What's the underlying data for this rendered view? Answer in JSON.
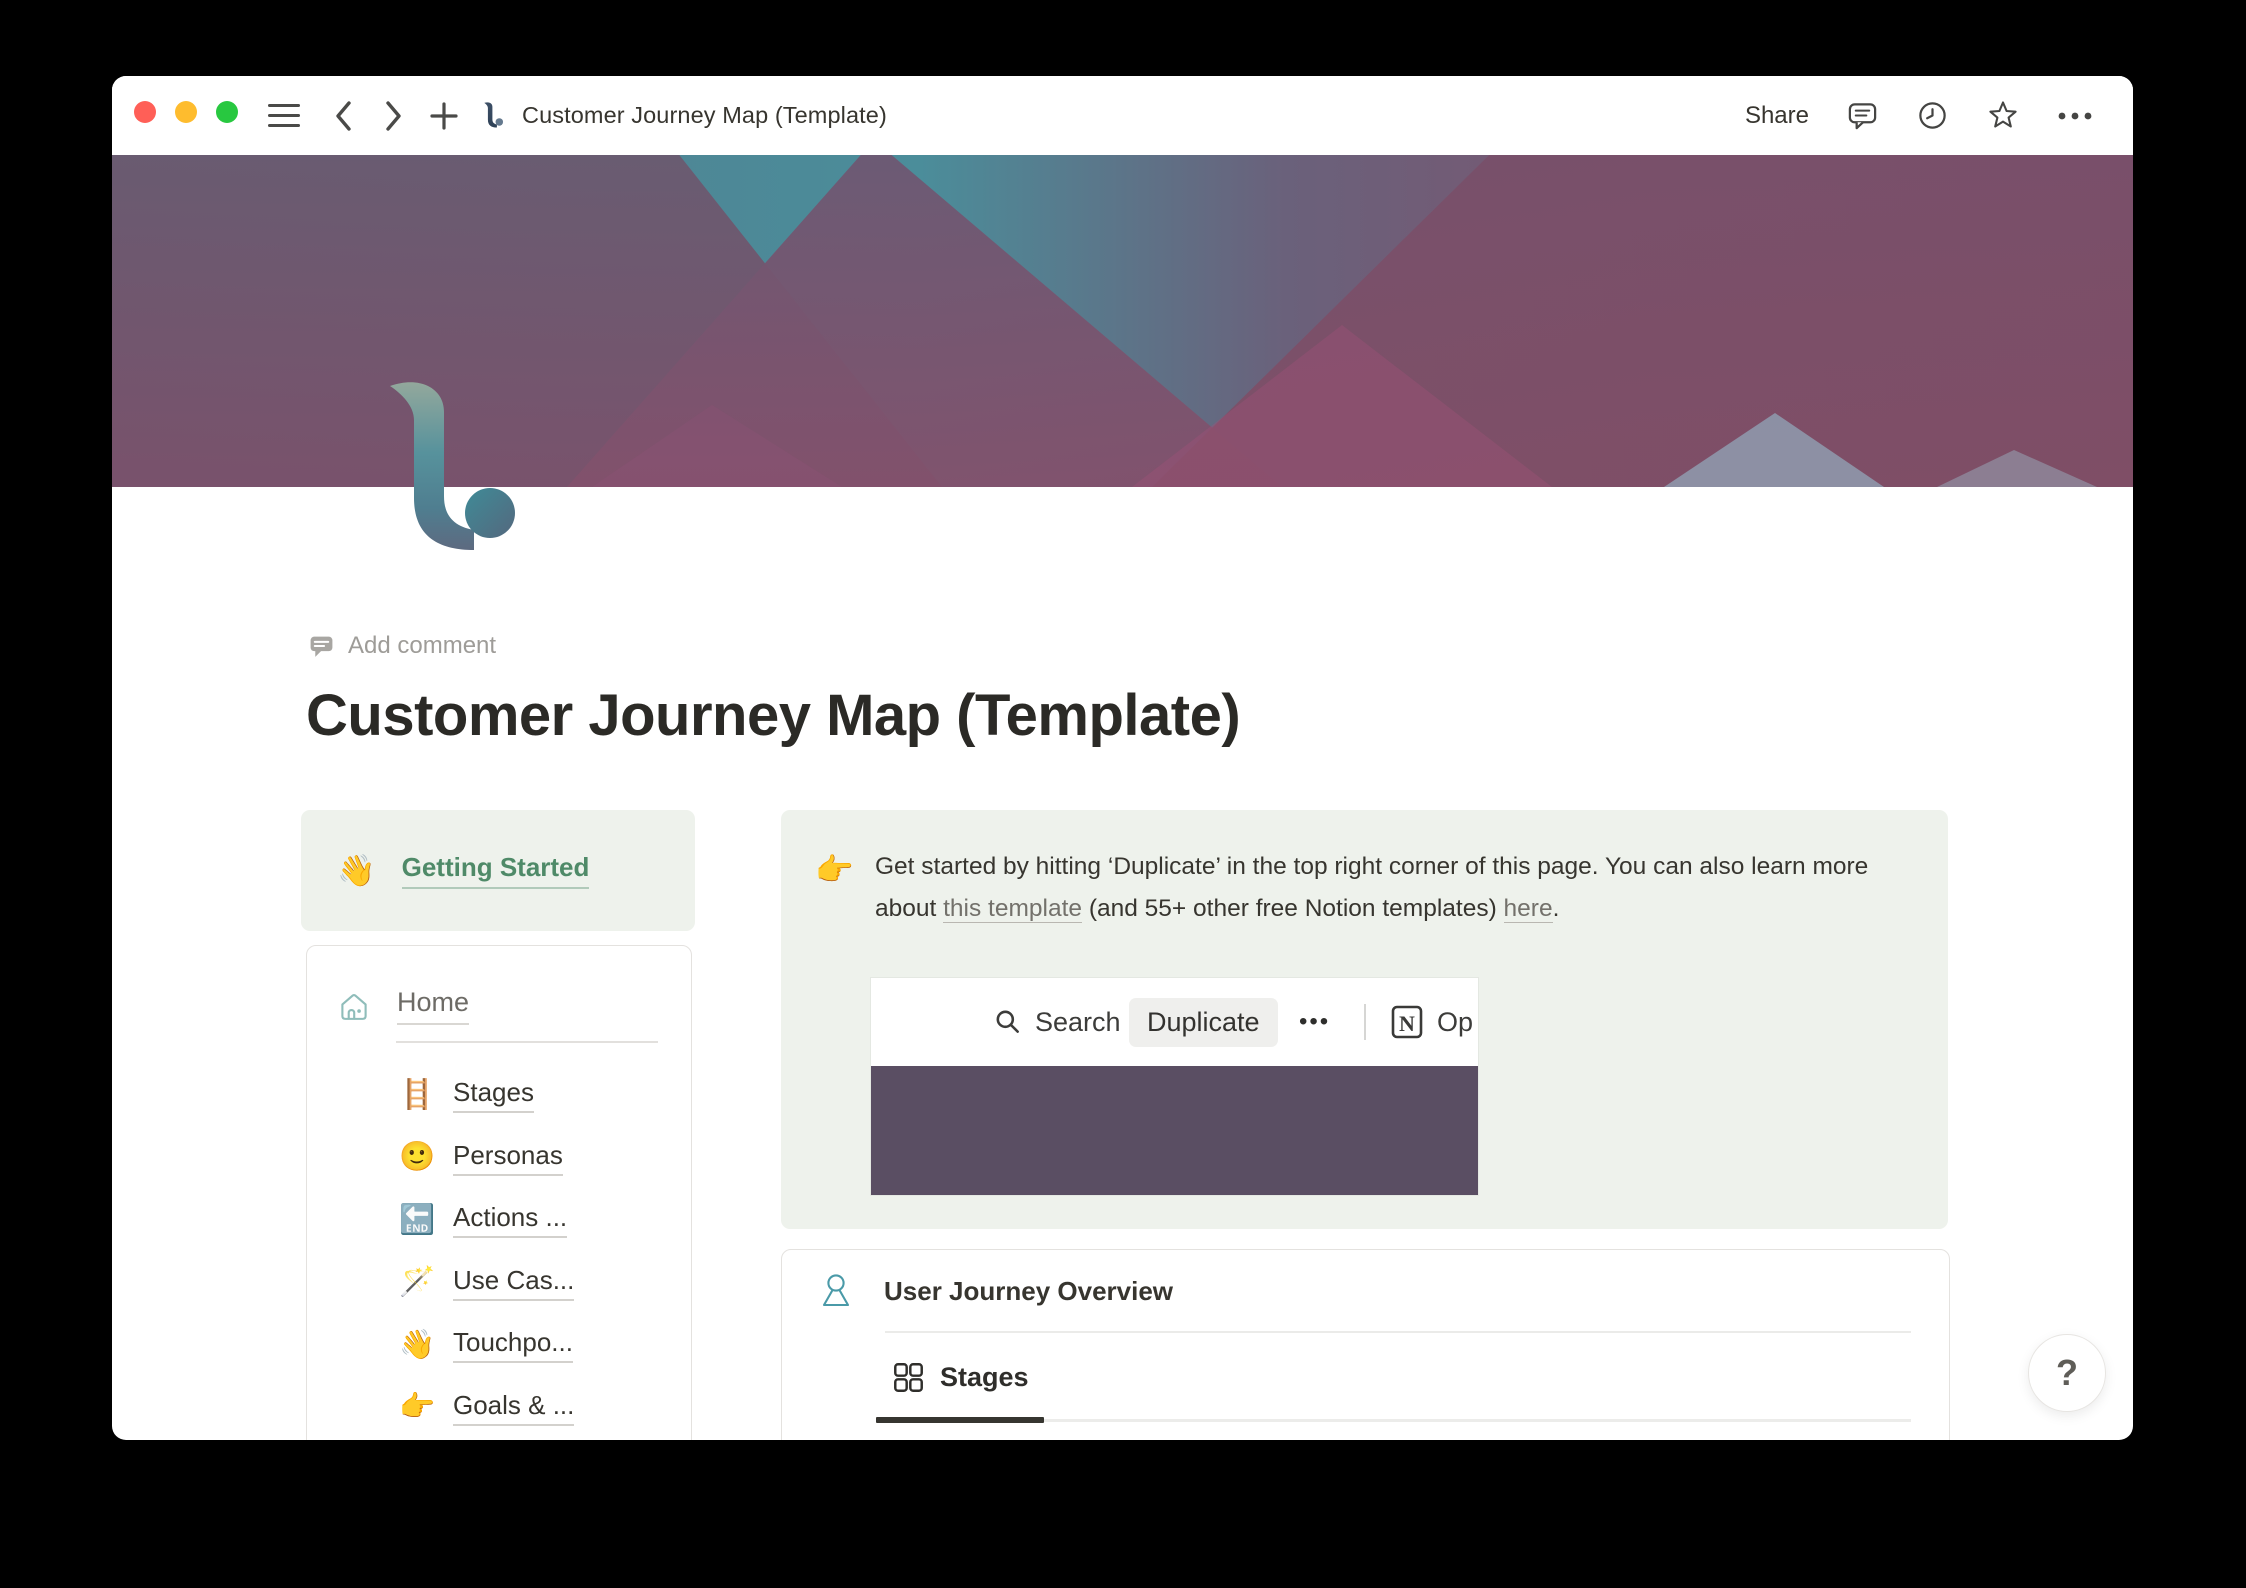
{
  "titlebar": {
    "title": "Customer Journey Map (Template)",
    "share_label": "Share"
  },
  "page": {
    "add_comment_label": "Add comment",
    "title": "Customer Journey Map (Template)"
  },
  "getting_started": {
    "emoji": "👋",
    "label": "Getting Started"
  },
  "home_card": {
    "label": "Home",
    "items": [
      {
        "emoji": "🪜",
        "label": "Stages"
      },
      {
        "emoji": "🙂",
        "label": "Personas"
      },
      {
        "emoji": "🔚",
        "label": "Actions ..."
      },
      {
        "emoji": "🪄",
        "label": "Use Cas..."
      },
      {
        "emoji": "👋",
        "label": "Touchpo..."
      },
      {
        "emoji": "👉",
        "label": "Goals & ..."
      }
    ]
  },
  "callout": {
    "emoji": "👉",
    "text_before_link1": "Get started by hitting ‘Duplicate’ in the top right corner of this page. You can also learn more about ",
    "link1": "this template",
    "text_between": " (and 55+ other free Notion templates) ",
    "link2": "here",
    "text_after": "."
  },
  "embed": {
    "search_label": "Search",
    "duplicate_label": "Duplicate",
    "more_label": "•••",
    "open_label": "Op"
  },
  "overview_card": {
    "title": "User Journey Overview",
    "tab_stages": "Stages"
  },
  "help_button_label": "?",
  "colors": {
    "green_text": "#4f8a68",
    "callout_bg": "#eef2ec",
    "banner_purple": "#5a4e63",
    "icon_teal": "#8fbdba",
    "cover_teal": "#4b8d9a",
    "cover_maroon": "#7f4d67",
    "cover_slate": "#5b6375"
  }
}
